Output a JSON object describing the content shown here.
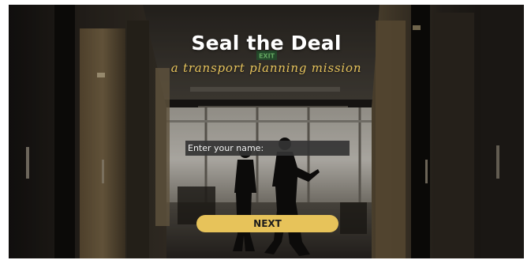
{
  "app": {
    "title": "Seal the Deal",
    "subtitle": "a transport planning mission"
  },
  "background": {
    "sign_text": "EXIT",
    "description_hidden": ""
  },
  "form": {
    "name_placeholder": "Enter your name:",
    "name_value": ""
  },
  "actions": {
    "next_label": "NEXT"
  },
  "colors": {
    "accent": "#e7c35a",
    "title": "#ffffff",
    "input_bg": "#343434"
  }
}
